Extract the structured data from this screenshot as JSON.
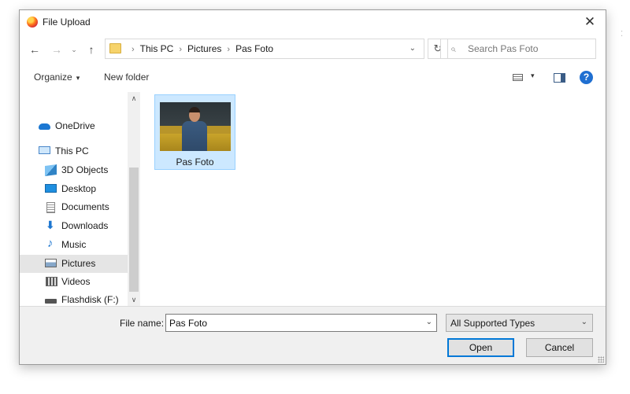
{
  "window": {
    "title": "File Upload",
    "close_glyph": "✕"
  },
  "nav": {
    "back_glyph": "←",
    "forward_glyph": "→",
    "recent_glyph": "⌄",
    "up_glyph": "↑",
    "refresh_glyph": "↻",
    "breadcrumb": [
      "This PC",
      "Pictures",
      "Pas Foto"
    ],
    "separator_glyph": "›",
    "dropdown_glyph": "⌄"
  },
  "search": {
    "placeholder": "Search Pas Foto",
    "icon_glyph": "⌕"
  },
  "toolbar": {
    "organize_label": "Organize",
    "organize_caret": "▾",
    "new_folder_label": "New folder",
    "view_caret": "▾",
    "help_glyph": "?"
  },
  "sidebar": {
    "scroll_up_glyph": "∧",
    "scroll_down_glyph": "∨",
    "items": [
      {
        "label": "OneDrive",
        "icon": "onedrive-icon"
      },
      {
        "label": "This PC",
        "icon": "computer-icon"
      },
      {
        "label": "3D Objects",
        "icon": "3d-objects-icon"
      },
      {
        "label": "Desktop",
        "icon": "desktop-icon"
      },
      {
        "label": "Documents",
        "icon": "documents-icon"
      },
      {
        "label": "Downloads",
        "icon": "download-arrow-icon",
        "glyph": "⬇"
      },
      {
        "label": "Music",
        "icon": "music-note-icon",
        "glyph": "♪"
      },
      {
        "label": "Pictures",
        "icon": "pictures-icon",
        "selected": true
      },
      {
        "label": "Videos",
        "icon": "videos-icon"
      },
      {
        "label": "Flashdisk (F:)",
        "icon": "usb-drive-icon"
      }
    ]
  },
  "files": [
    {
      "name": "Pas Foto",
      "selected": true
    }
  ],
  "footer": {
    "file_name_label": "File name:",
    "file_name_value": "Pas Foto",
    "file_name_caret": "⌄",
    "file_type_value": "All Supported Types",
    "file_type_caret": "⌄",
    "open_label": "Open",
    "cancel_label": "Cancel"
  },
  "colors": {
    "selection_bg": "#cce8ff",
    "selection_border": "#99d1ff",
    "accent": "#0078d7",
    "sidebar_selected": "#e5e5e5",
    "footer_bg": "#f0f0f0"
  }
}
